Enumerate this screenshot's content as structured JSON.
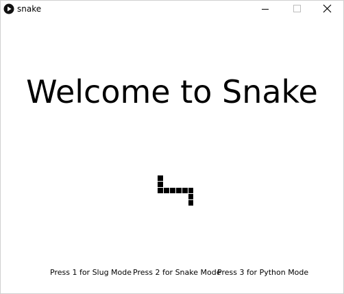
{
  "window": {
    "title": "snake",
    "icon": "play-icon",
    "controls": [
      "minimize-icon",
      "maximize-icon",
      "close-icon"
    ]
  },
  "game": {
    "welcome_text": "Welcome to Snake",
    "snake_color": "#000000",
    "background_color": "#ffffff",
    "menu_options": [
      "Press 1 for Slug Mode",
      "Press 2 for Snake Mode",
      "Press 3 for Python Mode"
    ]
  }
}
